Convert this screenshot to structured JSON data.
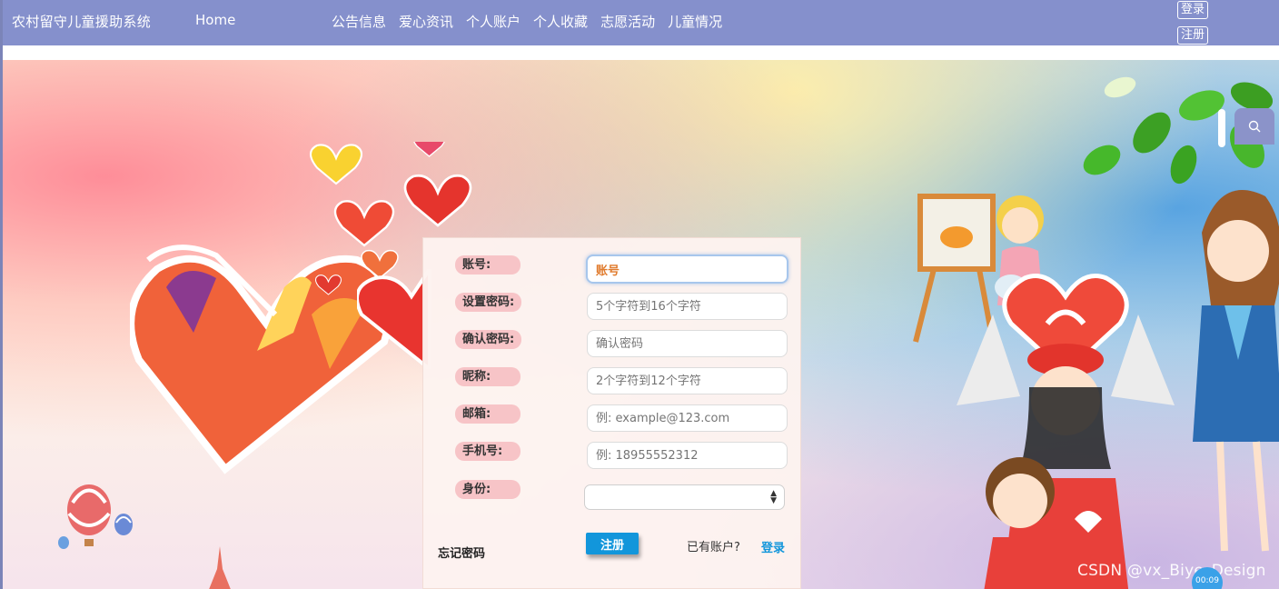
{
  "navbar": {
    "brand": "农村留守儿童援助系统",
    "home": "Home",
    "links": [
      "公告信息",
      "爱心资讯",
      "个人账户",
      "个人收藏",
      "志愿活动",
      "儿童情况"
    ],
    "login": "登录",
    "register": "注册"
  },
  "form": {
    "fields": [
      {
        "label": "账号:",
        "value": "账号",
        "placeholder": ""
      },
      {
        "label": "设置密码:",
        "value": "",
        "placeholder": "5个字符到16个字符"
      },
      {
        "label": "确认密码:",
        "value": "",
        "placeholder": "确认密码"
      },
      {
        "label": "昵称:",
        "value": "",
        "placeholder": "2个字符到12个字符"
      },
      {
        "label": "邮箱:",
        "value": "",
        "placeholder": "例: example@123.com"
      },
      {
        "label": "手机号:",
        "value": "",
        "placeholder": "例: 18955552312"
      }
    ],
    "role_label": "身份:",
    "role_selected": "",
    "forgot": "忘记密码",
    "submit": "注册",
    "have_account": "已有账户?",
    "login_link": "登录"
  },
  "icons": {
    "search": "search-icon"
  },
  "colors": {
    "navbar": "#8590cc",
    "label_pill": "#f7c4c7",
    "primary_button": "#1296db",
    "link": "#1296db"
  },
  "watermark": "CSDN @vx_Biye_Design",
  "timer": "00:09"
}
